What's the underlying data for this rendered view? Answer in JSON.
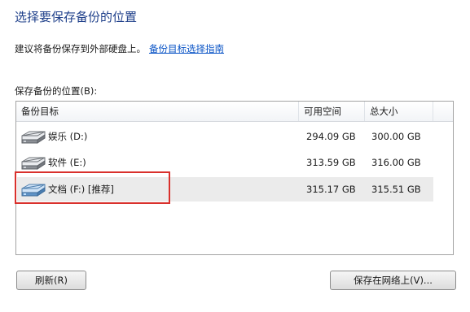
{
  "page": {
    "title": "选择要保存备份的位置",
    "hint_text": "建议将备份保存到外部硬盘上。",
    "hint_link": "备份目标选择指南",
    "list_label": "保存备份的位置(B):"
  },
  "table": {
    "columns": [
      "备份目标",
      "可用空间",
      "总大小"
    ],
    "rows": [
      {
        "name": "娱乐 (D:)",
        "available": "294.09 GB",
        "total": "300.00 GB",
        "icon": "hard-drive-icon",
        "selected": false
      },
      {
        "name": "软件 (E:)",
        "available": "313.59 GB",
        "total": "316.00 GB",
        "icon": "hard-drive-icon",
        "selected": false
      },
      {
        "name": "文档 (F:) [推荐]",
        "available": "315.17 GB",
        "total": "315.51 GB",
        "icon": "hard-drive-icon",
        "selected": true
      }
    ]
  },
  "buttons": {
    "refresh": "刷新(R)",
    "save_network": "保存在网络上(V)..."
  },
  "colors": {
    "title": "#1e3f8a",
    "link": "#0a54c6",
    "highlight": "#d9302c",
    "selected_row": "#ebebeb"
  }
}
